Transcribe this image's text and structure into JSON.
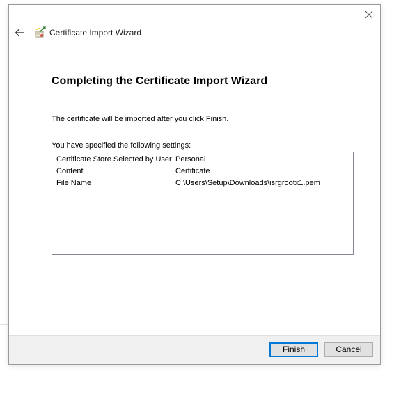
{
  "window": {
    "title": "Certificate Import Wizard",
    "close_icon": "close-icon",
    "back_icon": "back-arrow-icon",
    "app_icon": "certificate-wizard-icon"
  },
  "page": {
    "heading": "Completing the Certificate Import Wizard",
    "info": "The certificate will be imported after you click Finish.",
    "settings_label": "You have specified the following settings:"
  },
  "settings": [
    {
      "key": "Certificate Store Selected by User",
      "value": "Personal"
    },
    {
      "key": "Content",
      "value": "Certificate"
    },
    {
      "key": "File Name",
      "value": "C:\\Users\\Setup\\Downloads\\isrgrootx1.pem"
    }
  ],
  "footer": {
    "finish_label": "Finish",
    "cancel_label": "Cancel"
  },
  "colors": {
    "default_button_border": "#0078d7",
    "footer_background": "#f0f0f0"
  }
}
